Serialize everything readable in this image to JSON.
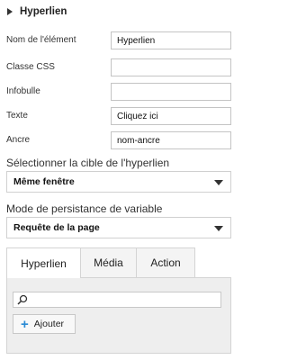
{
  "section": {
    "title": "Hyperlien"
  },
  "fields": [
    {
      "label": "Nom de l'élément",
      "value": "Hyperlien"
    },
    {
      "label": "Classe CSS",
      "value": ""
    },
    {
      "label": "Infobulle",
      "value": ""
    },
    {
      "label": "Texte",
      "value": "Cliquez ici"
    },
    {
      "label": "Ancre",
      "value": "nom-ancre"
    }
  ],
  "target": {
    "label": "Sélectionner la cible de l'hyperlien",
    "value": "Même fenêtre"
  },
  "persistence": {
    "label": "Mode de persistance de variable",
    "value": "Requête de la page"
  },
  "tabs": [
    {
      "label": "Hyperlien",
      "active": true
    },
    {
      "label": "Média",
      "active": false
    },
    {
      "label": "Action",
      "active": false
    }
  ],
  "search": {
    "value": ""
  },
  "add_button": {
    "label": "Ajouter"
  },
  "colors": {
    "accent": "#2a8ad4",
    "panel_bg": "#eeeeee",
    "border": "#c4c4c4"
  },
  "icons": {
    "section_toggle": "triangle-right-icon",
    "search": "magnifier-icon",
    "add": "plus-icon",
    "dropdown": "caret-down-icon"
  }
}
